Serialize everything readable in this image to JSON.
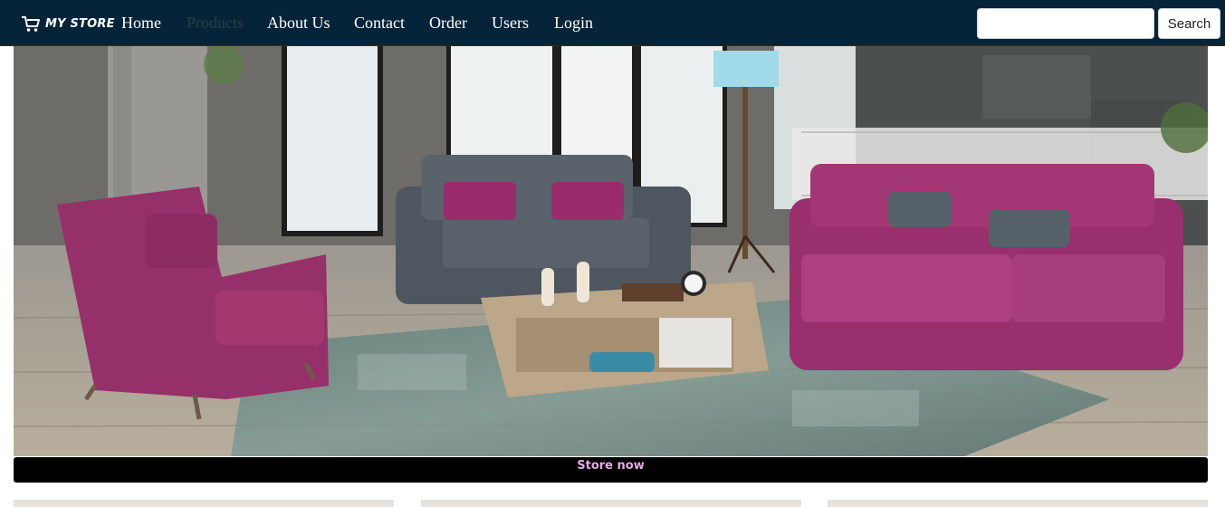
{
  "brand": {
    "name": "MY STORE",
    "icon": "cart-icon"
  },
  "nav": {
    "items": [
      {
        "label": "Home",
        "active": false
      },
      {
        "label": "Products",
        "active": true
      },
      {
        "label": "About Us",
        "active": false
      },
      {
        "label": "Contact",
        "active": false
      },
      {
        "label": "Order",
        "active": false
      },
      {
        "label": "Users",
        "active": false
      },
      {
        "label": "Login",
        "active": false
      }
    ]
  },
  "search": {
    "value": "",
    "button_label": "Search"
  },
  "hero": {
    "cta_label": "Store now"
  },
  "colors": {
    "navbar": "#05243a",
    "cta_background": "#000000",
    "cta_text": "#e8a8e8",
    "muted_nav": "#2c3b46"
  }
}
